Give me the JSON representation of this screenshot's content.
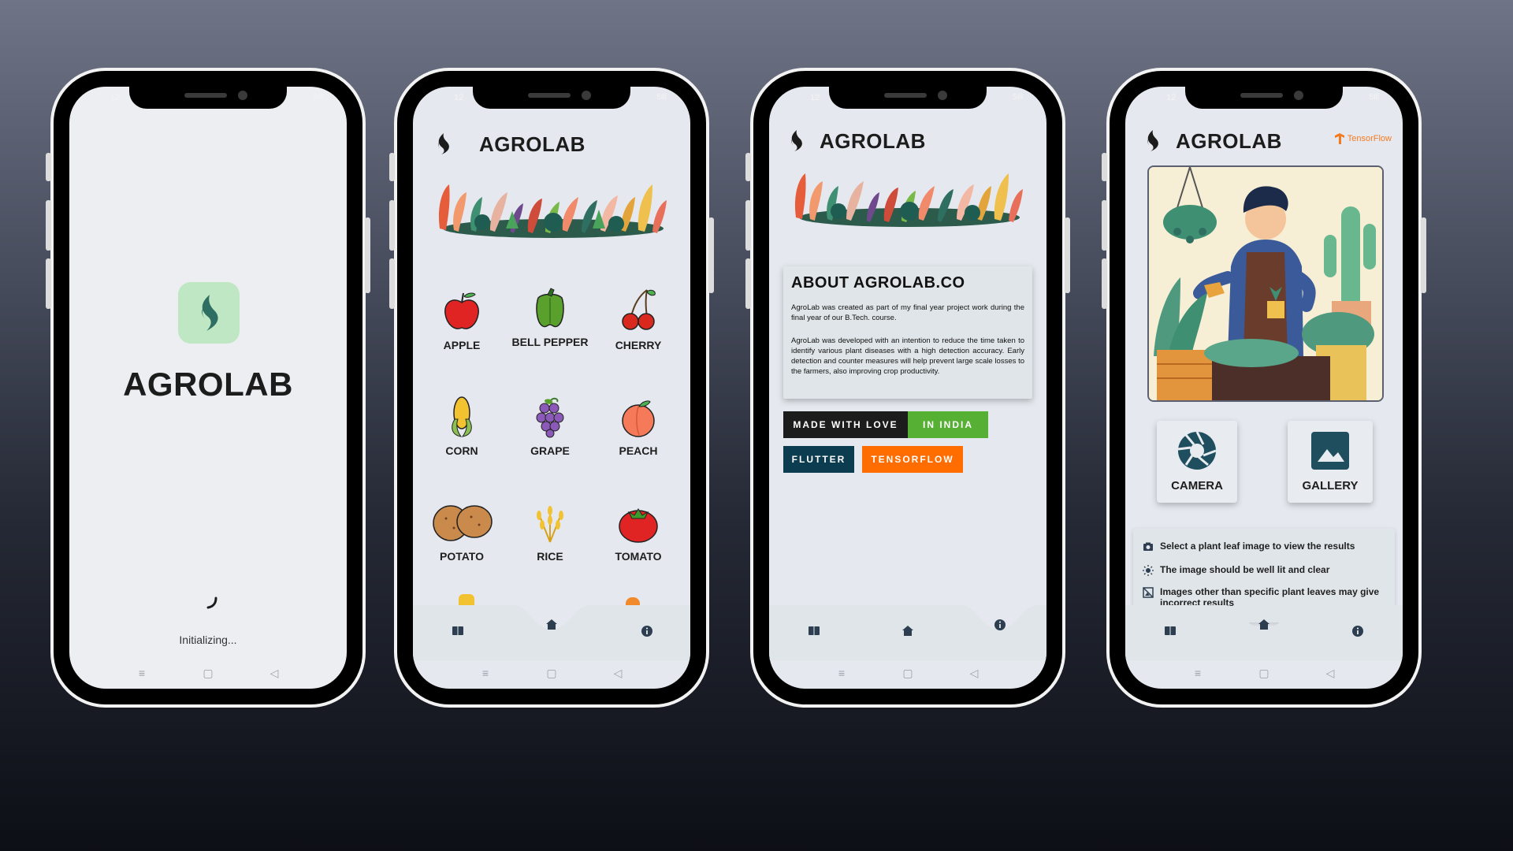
{
  "app": {
    "name": "AGROLAB"
  },
  "status_bar": {
    "time": "12",
    "right": "5Ill"
  },
  "splash": {
    "title": "AGROLAB",
    "loading_text": "Initializing..."
  },
  "crops": {
    "items": [
      {
        "label": "APPLE",
        "icon": "apple-icon"
      },
      {
        "label": "BELL PEPPER",
        "icon": "bell-pepper-icon"
      },
      {
        "label": "CHERRY",
        "icon": "cherry-icon"
      },
      {
        "label": "CORN",
        "icon": "corn-icon"
      },
      {
        "label": "GRAPE",
        "icon": "grape-icon"
      },
      {
        "label": "PEACH",
        "icon": "peach-icon"
      },
      {
        "label": "POTATO",
        "icon": "potato-icon"
      },
      {
        "label": "RICE",
        "icon": "rice-icon"
      },
      {
        "label": "TOMATO",
        "icon": "tomato-icon"
      }
    ]
  },
  "about": {
    "heading": "ABOUT AGROLAB.CO",
    "para1": "AgroLab was created as part of my final year project work during the final year of our B.Tech. course.",
    "para2": "AgroLab was developed with an intention to reduce the time taken to identify various plant diseases with a high detection accuracy. Early detection and counter measures will help prevent large scale losses to the farmers, also improving crop productivity.",
    "badges": {
      "made_with_love": "MADE WITH LOVE",
      "in_india": "IN INDIA",
      "flutter": "FLUTTER",
      "tensorflow": "TENSORFLOW"
    }
  },
  "detect": {
    "tensorflow_logo": "TensorFlow",
    "camera_label": "CAMERA",
    "gallery_label": "GALLERY",
    "tips": [
      "Select a plant leaf image to view the results",
      "The image should be well lit and clear",
      "Images other than specific plant leaves may give incorrect results"
    ]
  },
  "colors": {
    "accent_dark": "#1f4e5f",
    "green": "#55b033",
    "orange": "#ff6d00",
    "flutter_badge": "#0b3c4f"
  }
}
